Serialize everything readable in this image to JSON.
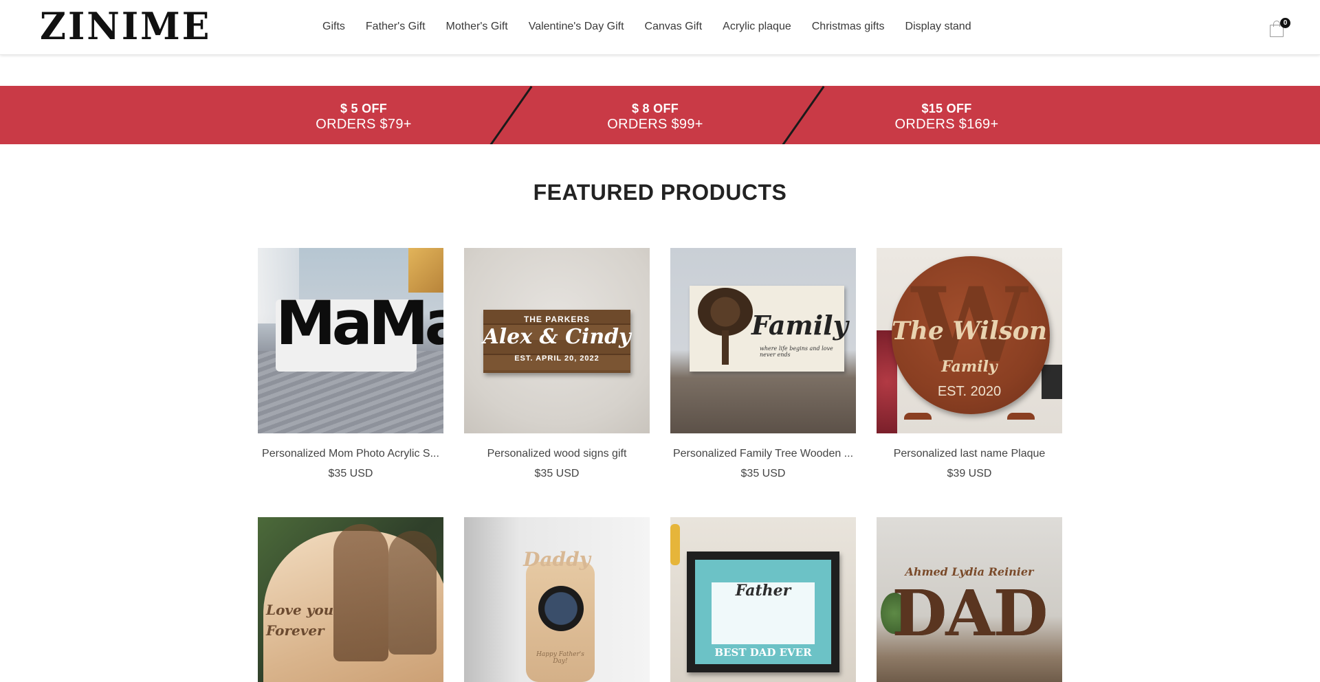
{
  "header": {
    "logo": "ZINIME",
    "nav": [
      "Gifts",
      "Father's Gift",
      "Mother's Gift",
      "Valentine's Day Gift",
      "Canvas Gift",
      "Acrylic plaque",
      "Christmas gifts",
      "Display stand"
    ],
    "cart_count": "0",
    "cart_icon": "shopping-bag-icon"
  },
  "promo": [
    {
      "line1": "$ 5 OFF",
      "line2": "ORDERS $79+"
    },
    {
      "line1": "$ 8 OFF",
      "line2": "ORDERS $99+"
    },
    {
      "line1": "$15 OFF",
      "line2": "ORDERS $169+"
    }
  ],
  "colors": {
    "promo_bg": "#c93a46",
    "divider": "#1a1a1a"
  },
  "featured": {
    "title": "FEATURED PRODUCTS",
    "products": [
      {
        "title": "Personalized Mom Photo Acrylic S...",
        "price": "$35 USD",
        "art_text": "MaMa"
      },
      {
        "title": "Personalized wood signs gift",
        "price": "$35 USD",
        "art_top": "THE PARKERS",
        "art_main": "Alex & Cindy",
        "art_bottom": "EST. APRIL 20, 2022"
      },
      {
        "title": "Personalized Family Tree Wooden ...",
        "price": "$35 USD",
        "art_main": "Family",
        "art_sub": "where life begins and love never ends"
      },
      {
        "title": "Personalized last name Plaque",
        "price": "$39 USD",
        "art_letter": "W",
        "art_main": "The Wilson",
        "art_sub": "Family",
        "art_bottom": "EST. 2020"
      },
      {
        "title": "",
        "price": "",
        "art_main": "Love you Forever"
      },
      {
        "title": "",
        "price": "",
        "art_main": "Daddy",
        "art_sub": "Happy Father's Day!"
      },
      {
        "title": "",
        "price": "",
        "art_main": "Father",
        "art_bottom": "BEST DAD EVER"
      },
      {
        "title": "",
        "price": "",
        "art_top": "Ahmed Lydia Reinier",
        "art_main": "DAD"
      }
    ]
  }
}
